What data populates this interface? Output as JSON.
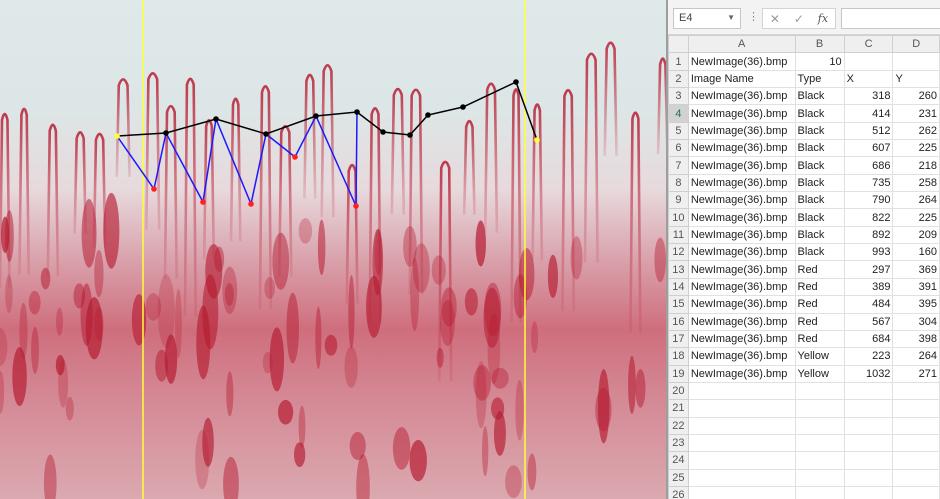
{
  "spreadsheet": {
    "name_box": "E4",
    "formula_buttons": {
      "cancel": "✕",
      "enter": "✓",
      "fx": "fx"
    },
    "columns": [
      "A",
      "B",
      "C",
      "D"
    ],
    "rows": [
      {
        "num": "1",
        "cells": [
          "NewImage(36).bmp",
          "10",
          "",
          ""
        ]
      },
      {
        "num": "2",
        "cells": [
          "Image Name",
          "Type",
          "X",
          "Y"
        ]
      },
      {
        "num": "3",
        "cells": [
          "NewImage(36).bmp",
          "Black",
          "318",
          "260"
        ]
      },
      {
        "num": "4",
        "cells": [
          "NewImage(36).bmp",
          "Black",
          "414",
          "231"
        ]
      },
      {
        "num": "5",
        "cells": [
          "NewImage(36).bmp",
          "Black",
          "512",
          "262"
        ]
      },
      {
        "num": "6",
        "cells": [
          "NewImage(36).bmp",
          "Black",
          "607",
          "225"
        ]
      },
      {
        "num": "7",
        "cells": [
          "NewImage(36).bmp",
          "Black",
          "686",
          "218"
        ]
      },
      {
        "num": "8",
        "cells": [
          "NewImage(36).bmp",
          "Black",
          "735",
          "258"
        ]
      },
      {
        "num": "9",
        "cells": [
          "NewImage(36).bmp",
          "Black",
          "790",
          "264"
        ]
      },
      {
        "num": "10",
        "cells": [
          "NewImage(36).bmp",
          "Black",
          "822",
          "225"
        ]
      },
      {
        "num": "11",
        "cells": [
          "NewImage(36).bmp",
          "Black",
          "892",
          "209"
        ]
      },
      {
        "num": "12",
        "cells": [
          "NewImage(36).bmp",
          "Black",
          "993",
          "160"
        ]
      },
      {
        "num": "13",
        "cells": [
          "NewImage(36).bmp",
          "Red",
          "297",
          "369"
        ]
      },
      {
        "num": "14",
        "cells": [
          "NewImage(36).bmp",
          "Red",
          "389",
          "391"
        ]
      },
      {
        "num": "15",
        "cells": [
          "NewImage(36).bmp",
          "Red",
          "484",
          "395"
        ]
      },
      {
        "num": "16",
        "cells": [
          "NewImage(36).bmp",
          "Red",
          "567",
          "304"
        ]
      },
      {
        "num": "17",
        "cells": [
          "NewImage(36).bmp",
          "Red",
          "684",
          "398"
        ]
      },
      {
        "num": "18",
        "cells": [
          "NewImage(36).bmp",
          "Yellow",
          "223",
          "264"
        ]
      },
      {
        "num": "19",
        "cells": [
          "NewImage(36).bmp",
          "Yellow",
          "1032",
          "271"
        ]
      },
      {
        "num": "20",
        "cells": [
          "",
          "",
          "",
          ""
        ]
      },
      {
        "num": "21",
        "cells": [
          "",
          "",
          "",
          ""
        ]
      },
      {
        "num": "22",
        "cells": [
          "",
          "",
          "",
          ""
        ]
      },
      {
        "num": "23",
        "cells": [
          "",
          "",
          "",
          ""
        ]
      },
      {
        "num": "24",
        "cells": [
          "",
          "",
          "",
          ""
        ]
      },
      {
        "num": "25",
        "cells": [
          "",
          "",
          "",
          ""
        ]
      },
      {
        "num": "26",
        "cells": [
          "",
          "",
          "",
          ""
        ]
      }
    ]
  },
  "image_annotations": {
    "colors": {
      "black_line": "#000000",
      "blue_line": "#1a1aff",
      "red_point": "#ff2020",
      "yellow_line": "#ffff33"
    }
  }
}
